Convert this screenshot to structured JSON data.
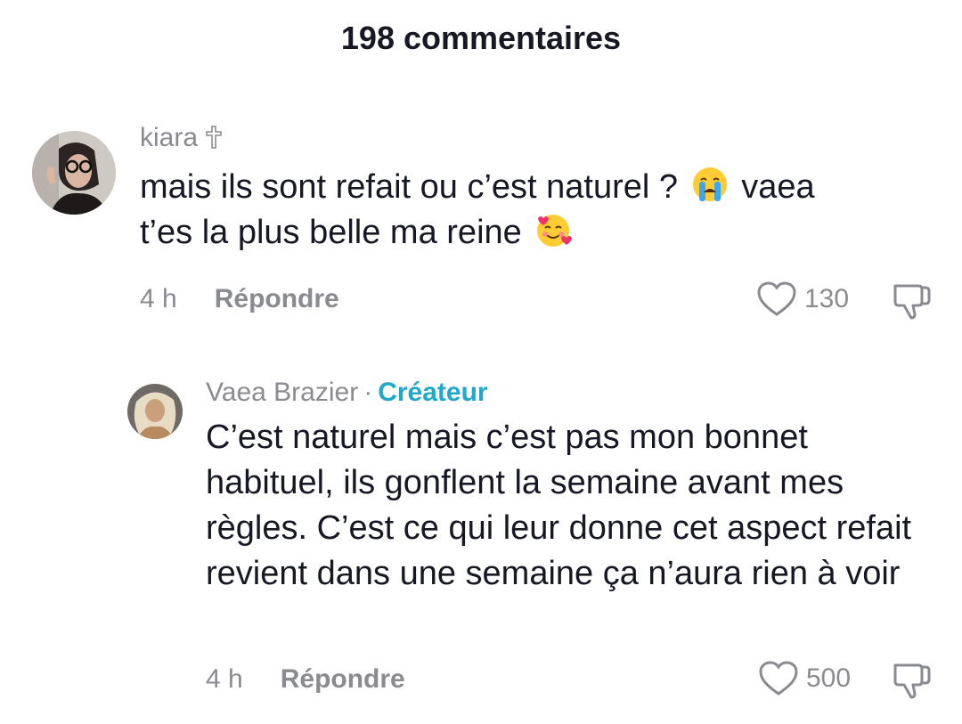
{
  "header": {
    "title": "198 commentaires"
  },
  "comments": [
    {
      "username": "kiara",
      "badge_icon": "cross-icon",
      "text_line1": "mais ils sont refait ou c’est naturel ?",
      "emoji1": "crying-face-emoji",
      "text_line1_tail": "vaea",
      "text_line2": "t’es la plus belle ma reine",
      "emoji2": "smiling-face-with-hearts-emoji",
      "time": "4 h",
      "reply_label": "Répondre",
      "likes": "130"
    },
    {
      "username": "Vaea Brazier",
      "separator": "·",
      "role": "Créateur",
      "text": "C’est naturel mais c’est pas mon bonnet habituel, ils gonflent la semaine avant mes règles. C’est ce qui leur donne cet aspect refait revient dans une semaine ça n’aura rien à voir",
      "time": "4 h",
      "reply_label": "Répondre",
      "likes": "500"
    }
  ],
  "colors": {
    "text": "#161823",
    "muted": "#8a8b91",
    "creator": "#20a7c9"
  }
}
